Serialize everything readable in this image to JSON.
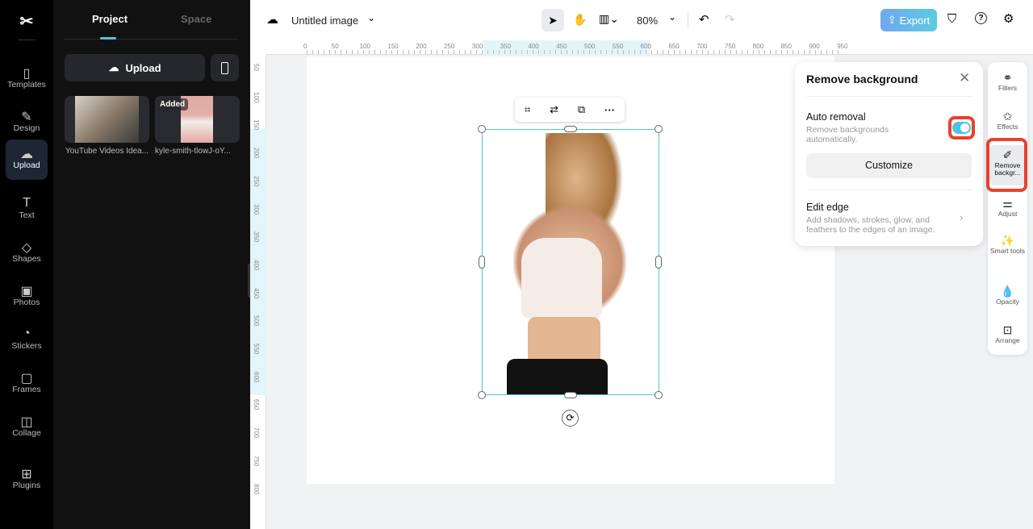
{
  "rail": {
    "items": [
      {
        "label": "Templates",
        "icon": "template-icon"
      },
      {
        "label": "Design",
        "icon": "design-icon"
      },
      {
        "label": "Upload",
        "icon": "upload-icon"
      },
      {
        "label": "Text",
        "icon": "text-icon"
      },
      {
        "label": "Shapes",
        "icon": "shapes-icon"
      },
      {
        "label": "Photos",
        "icon": "photos-icon"
      },
      {
        "label": "Stickers",
        "icon": "stickers-icon"
      },
      {
        "label": "Frames",
        "icon": "frames-icon"
      },
      {
        "label": "Collage",
        "icon": "collage-icon"
      },
      {
        "label": "Plugins",
        "icon": "plugins-icon"
      }
    ]
  },
  "panel": {
    "tabs": [
      "Project",
      "Space"
    ],
    "upload": "Upload",
    "assets": [
      {
        "name": "YouTube Videos Idea..."
      },
      {
        "name": "kyle-smith-tlowJ-oY...",
        "badge": "Added"
      }
    ]
  },
  "topbar": {
    "title": "Untitled image",
    "zoom": "80%",
    "export": "Export"
  },
  "ruler": {
    "h": [
      "0",
      "50",
      "100",
      "150",
      "200",
      "250",
      "300",
      "350",
      "400",
      "450",
      "500",
      "550",
      "600",
      "650",
      "700",
      "750",
      "800",
      "850",
      "900",
      "950"
    ],
    "v": [
      "50",
      "100",
      "150",
      "200",
      "250",
      "300",
      "350",
      "400",
      "450",
      "500",
      "550",
      "600",
      "650",
      "700",
      "750",
      "800"
    ]
  },
  "removebg": {
    "title": "Remove background",
    "auto_title": "Auto removal",
    "auto_desc": "Remove backgrounds automatically.",
    "auto_on": true,
    "customize": "Customize",
    "edge_title": "Edit edge",
    "edge_desc": "Add shadows, strokes, glow, and feathers to the edges of an image."
  },
  "sidebar": {
    "items": [
      "Filters",
      "Effects",
      "Remove backgr...",
      "Adjust",
      "Smart tools",
      "Opacity",
      "Arrange"
    ]
  },
  "colors": {
    "accent": "#4cc5e0",
    "highlight": "#e8412c"
  }
}
